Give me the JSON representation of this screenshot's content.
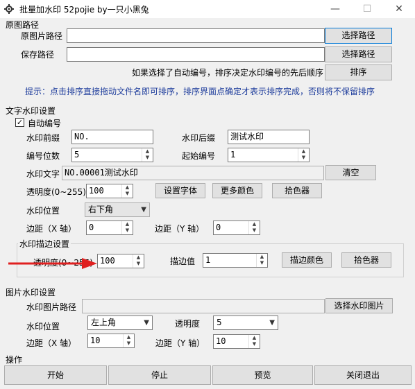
{
  "window": {
    "title": "批量加水印 52pojie by一只小黑兔",
    "controls": {
      "minimize": "—",
      "maximize": "☐",
      "close": "✕"
    }
  },
  "source": {
    "group_label": "原图路径",
    "image_path_label": "原图片路径",
    "image_path_value": "",
    "image_path_button": "选择路径",
    "save_path_label": "保存路径",
    "save_path_value": "",
    "save_path_button": "选择路径",
    "sort_note": "如果选择了自动编号，排序决定水印编号的先后顺序",
    "sort_button": "排序",
    "tip": "提示：点击排序直接拖动文件名即可排序，排序界面点确定才表示排序完成，否则将不保留排序"
  },
  "text_watermark": {
    "group_label": "文字水印设置",
    "auto_number_label": "自动编号",
    "auto_number_checked": true,
    "prefix_label": "水印前缀",
    "prefix_value": "NO.",
    "suffix_label": "水印后缀",
    "suffix_value": "测试水印",
    "digits_label": "编号位数",
    "digits_value": "5",
    "start_label": "起始编号",
    "start_value": "1",
    "text_label": "水印文字",
    "text_value": "NO.00001测试水印",
    "clear_button": "清空",
    "opacity_label": "透明度(0~255)",
    "opacity_value": "100",
    "font_button": "设置字体",
    "more_colors_button": "更多颜色",
    "picker_button": "拾色器",
    "position_label": "水印位置",
    "position_value": "右下角",
    "margin_x_label": "边距（X 轴）",
    "margin_x_value": "0",
    "margin_y_label": "边距（Y 轴）",
    "margin_y_value": "0"
  },
  "stroke": {
    "group_label": "水印描边设置",
    "opacity_label": "透明度(0~255)",
    "opacity_value": "100",
    "width_label": "描边值",
    "width_value": "1",
    "color_button": "描边颜色",
    "picker_button": "拾色器"
  },
  "image_watermark": {
    "group_label": "图片水印设置",
    "path_label": "水印图片路径",
    "path_value": "",
    "choose_button": "选择水印图片",
    "position_label": "水印位置",
    "position_value": "左上角",
    "opacity_label": "透明度",
    "opacity_value": "5",
    "margin_x_label": "边距（X 轴）",
    "margin_x_value": "10",
    "margin_y_label": "边距（Y 轴）",
    "margin_y_value": "10"
  },
  "actions": {
    "group_label": "操作",
    "start": "开始",
    "stop": "停止",
    "preview": "预览",
    "close": "关闭退出"
  },
  "colors": {
    "hint": "#1e3d9c",
    "annotation_arrow": "#e02020",
    "focus_border": "#0078d7"
  }
}
